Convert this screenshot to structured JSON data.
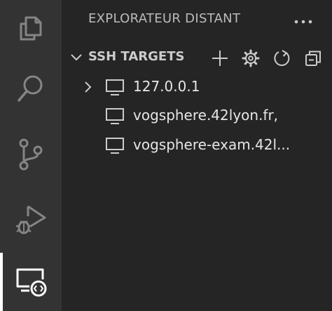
{
  "sidebar": {
    "title": "EXPLORATEUR DISTANT",
    "section": {
      "title": "SSH TARGETS",
      "actions": [
        "add-icon",
        "gear-icon",
        "refresh-icon",
        "collapse-all-icon"
      ]
    },
    "targets": [
      {
        "label": "127.0.0.1",
        "expandable": true
      },
      {
        "label": "vogsphere.42lyon.fr,",
        "expandable": false
      },
      {
        "label": "vogsphere-exam.42l...",
        "expandable": false
      }
    ]
  },
  "activity_bar": {
    "items": [
      "files-icon",
      "search-icon",
      "source-control-icon",
      "run-debug-icon",
      "remote-explorer-icon"
    ],
    "active": "remote-explorer-icon"
  },
  "colors": {
    "activity_bar_bg": "#333333",
    "sidebar_bg": "#252526",
    "icon_inactive": "#858585",
    "icon_active": "#ffffff",
    "text": "#cccccc"
  }
}
